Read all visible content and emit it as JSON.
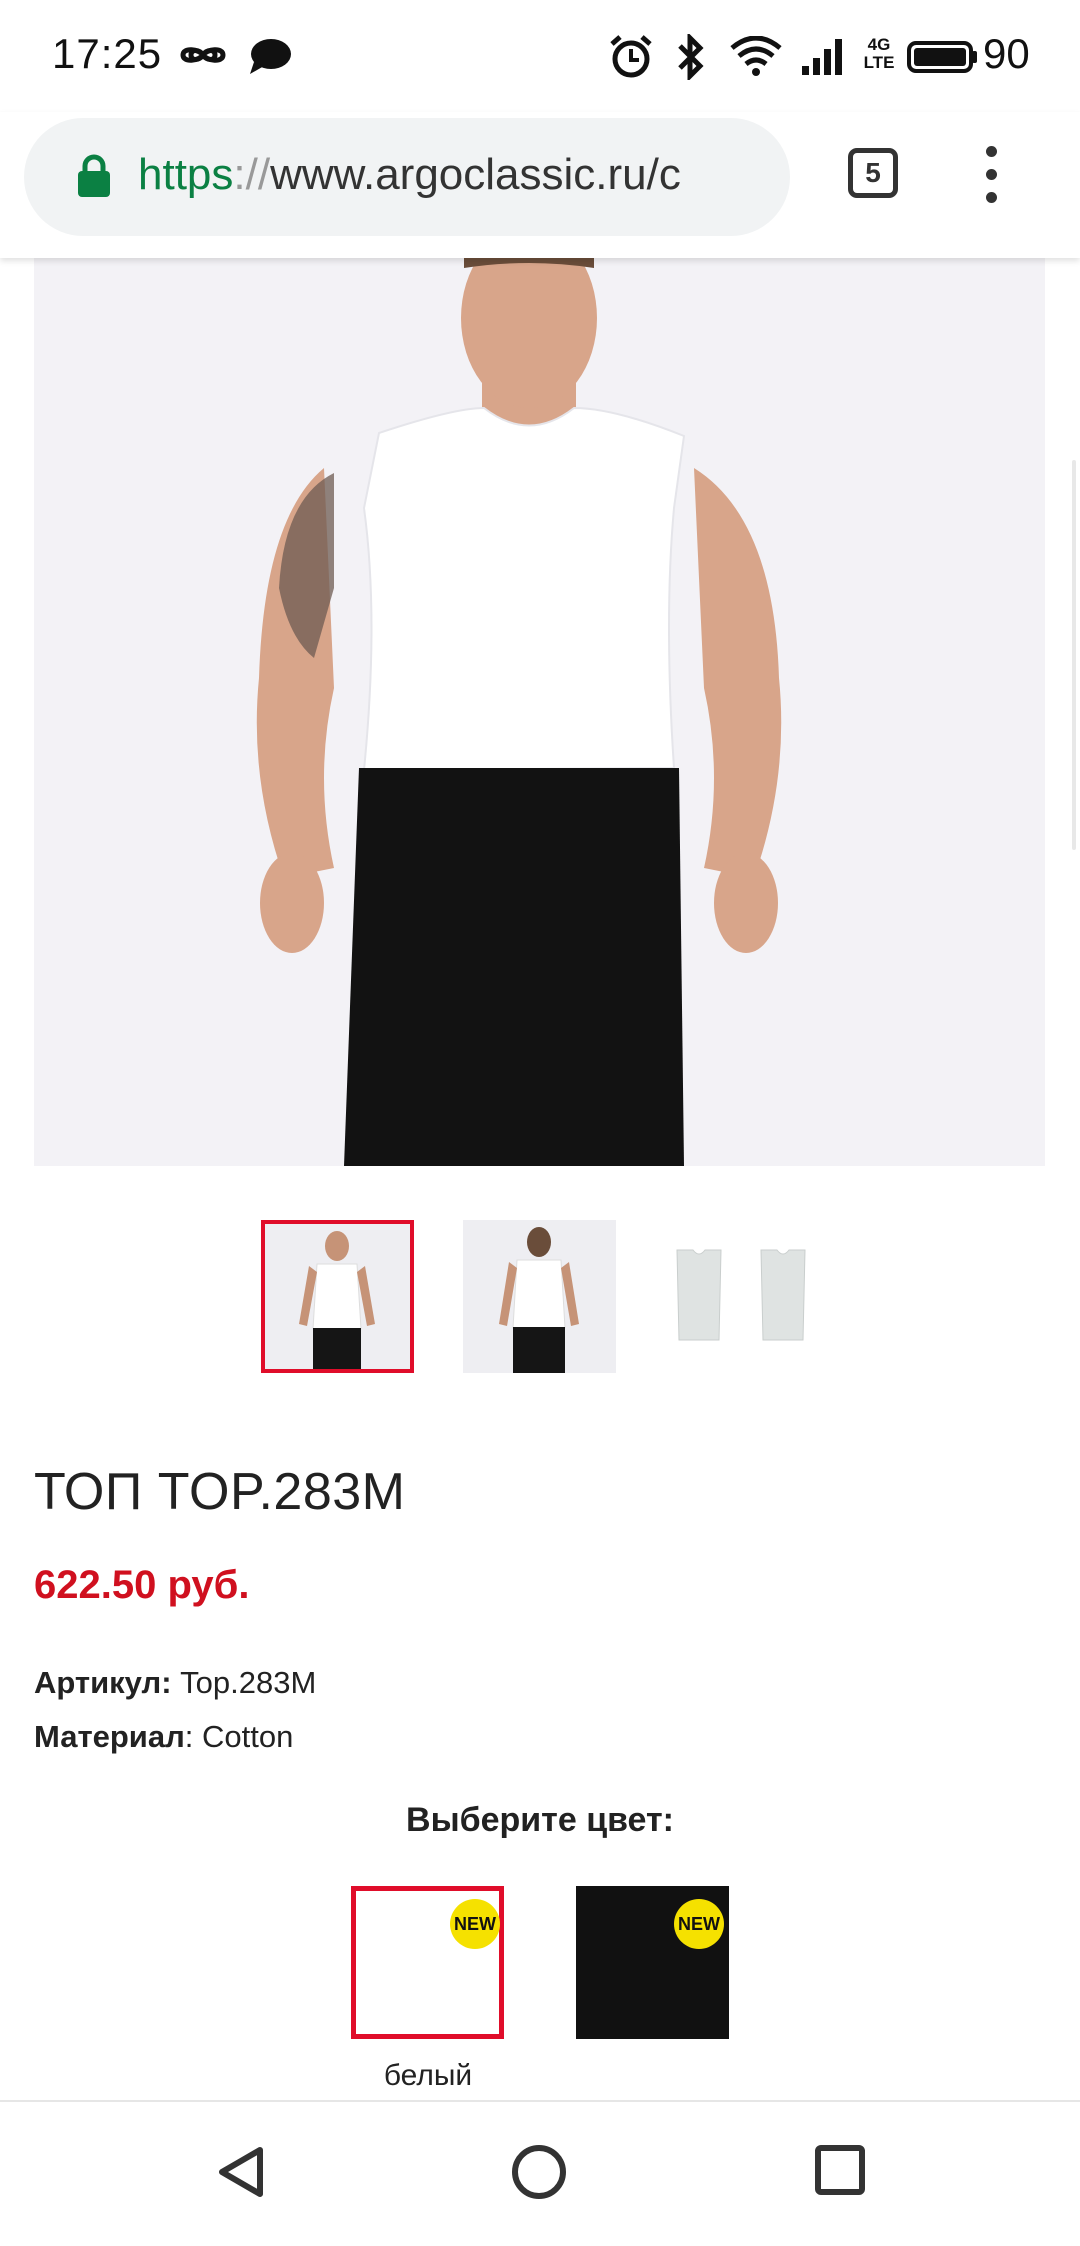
{
  "status_bar": {
    "time": "17:25",
    "battery": "90",
    "icons": [
      "infinity-icon",
      "chat-bubble-icon",
      "alarm-icon",
      "bluetooth-icon",
      "wifi-icon",
      "signal-icon",
      "lte-icon",
      "battery-icon"
    ]
  },
  "browser": {
    "url_scheme": "https",
    "url_sep": "://",
    "url_rest": "www.argoclassic.ru/c",
    "tab_count": "5"
  },
  "gallery": {
    "thumbnails": [
      "front",
      "back",
      "flat"
    ],
    "selected_index": 0
  },
  "product": {
    "title": "ТОП TOP.283M",
    "price": "622.50 руб.",
    "sku_label": "Артикул:",
    "sku_value": " Top.283M",
    "material_label": "Материал",
    "material_value": ": Cotton"
  },
  "color_picker": {
    "heading": "Выберите цвет:",
    "options": [
      {
        "label": "белый",
        "swatch": "#ffffff",
        "badge": "NEW",
        "selected": true
      },
      {
        "label": "",
        "swatch": "#111111",
        "badge": "NEW",
        "selected": false
      }
    ]
  },
  "colors": {
    "accent_red": "#e00d2a",
    "price_red": "#d0101f",
    "badge_yellow": "#f5e100",
    "url_green": "#0b8043"
  }
}
